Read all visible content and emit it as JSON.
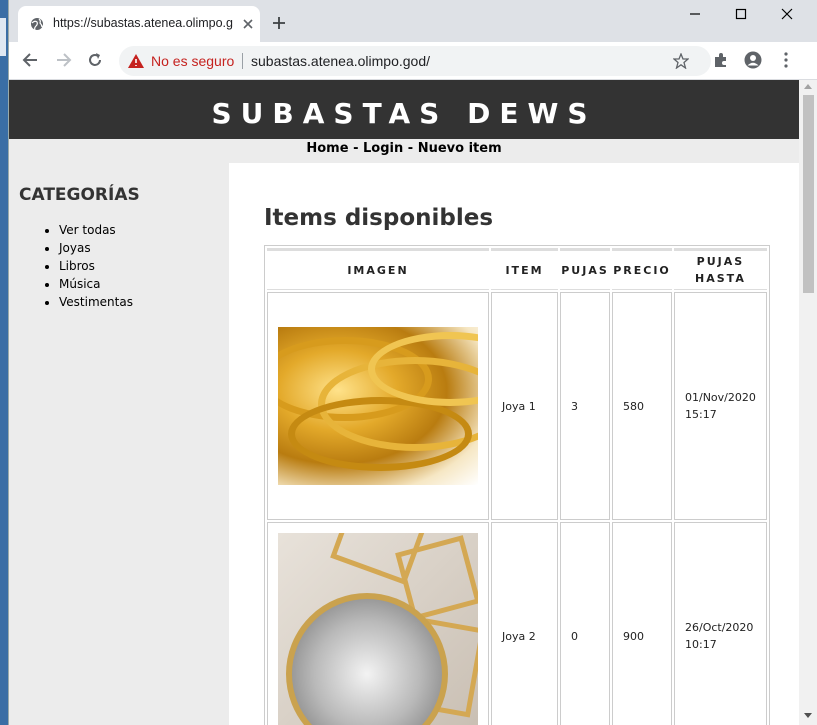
{
  "browser": {
    "tab_title": "https://subastas.atenea.olimpo.god/",
    "security_label": "No es seguro",
    "url": "subastas.atenea.olimpo.god/"
  },
  "site": {
    "title": "SUBASTAS DEWS",
    "nav": [
      "Home",
      "Login",
      "Nuevo item"
    ],
    "nav_separator": " - "
  },
  "sidebar": {
    "heading": "CATEGORÍAS",
    "items": [
      "Ver todas",
      "Joyas",
      "Libros",
      "Música",
      "Vestimentas"
    ]
  },
  "main": {
    "heading": "Items disponibles",
    "columns": [
      "IMAGEN",
      "ITEM",
      "PUJAS",
      "PRECIO",
      "PUJAS HASTA"
    ],
    "rows": [
      {
        "item": "Joya 1",
        "pujas": "3",
        "precio": "580",
        "hasta_date": "01/Nov/2020",
        "hasta_time": "15:17"
      },
      {
        "item": "Joya 2",
        "pujas": "0",
        "precio": "900",
        "hasta_date": "26/Oct/2020",
        "hasta_time": "10:17"
      }
    ]
  },
  "colors": {
    "header_bg": "#333333",
    "insecure_red": "#c5221f"
  }
}
